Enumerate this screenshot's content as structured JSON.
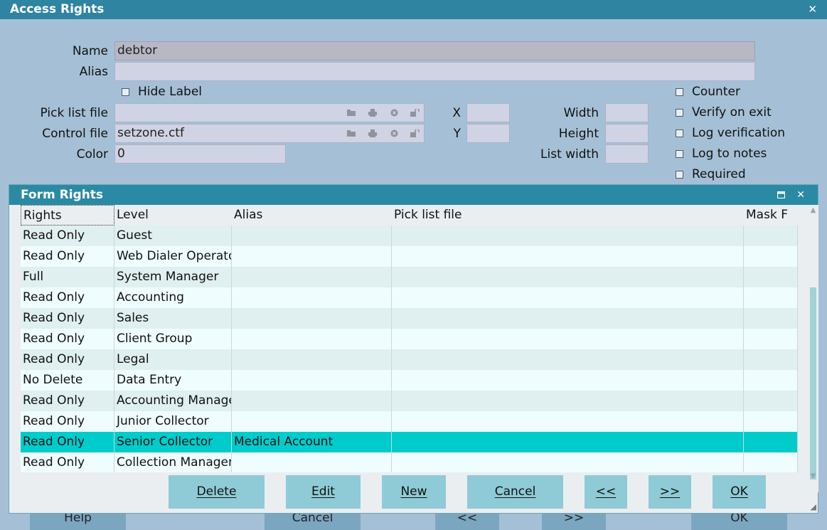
{
  "window": {
    "title": "Access Rights",
    "close_glyph": "✕"
  },
  "form": {
    "name_label": "Name",
    "name_value": "debtor",
    "alias_label": "Alias",
    "alias_value": "",
    "hide_label": "Hide Label",
    "pick_list_label": "Pick list file",
    "pick_list_value": "",
    "control_file_label": "Control file",
    "control_file_value": "setzone.ctf",
    "color_label": "Color",
    "color_value": "0",
    "x_label": "X",
    "x_value": "",
    "y_label": "Y",
    "y_value": "",
    "width_label": "Width",
    "width_value": "",
    "height_label": "Height",
    "height_value": "",
    "list_width_label": "List width",
    "list_width_value": "",
    "checkboxes": [
      "Counter",
      "Verify on exit",
      "Log verification",
      "Log to notes",
      "Required"
    ]
  },
  "behind_buttons": [
    "Help",
    "Cancel",
    "<<",
    ">>",
    "OK"
  ],
  "inner": {
    "title": "Form Rights",
    "columns": [
      "Rights",
      "Level",
      "Alias",
      "Pick list file",
      "Mask F"
    ],
    "rows": [
      {
        "rights": "Read Only",
        "level": "Guest",
        "alias": "",
        "pick": "",
        "mask": ""
      },
      {
        "rights": "Read Only",
        "level": "Web Dialer Operator",
        "alias": "",
        "pick": "",
        "mask": ""
      },
      {
        "rights": "Full",
        "level": "System Manager",
        "alias": "",
        "pick": "",
        "mask": ""
      },
      {
        "rights": "Read Only",
        "level": "Accounting",
        "alias": "",
        "pick": "",
        "mask": ""
      },
      {
        "rights": "Read Only",
        "level": "Sales",
        "alias": "",
        "pick": "",
        "mask": ""
      },
      {
        "rights": "Read Only",
        "level": "Client Group",
        "alias": "",
        "pick": "",
        "mask": ""
      },
      {
        "rights": "Read Only",
        "level": "Legal",
        "alias": "",
        "pick": "",
        "mask": ""
      },
      {
        "rights": "No Delete",
        "level": "Data Entry",
        "alias": "",
        "pick": "",
        "mask": ""
      },
      {
        "rights": "Read Only",
        "level": "Accounting Manager",
        "alias": "",
        "pick": "",
        "mask": ""
      },
      {
        "rights": "Read Only",
        "level": "Junior Collector",
        "alias": "",
        "pick": "",
        "mask": ""
      },
      {
        "rights": "Read Only",
        "level": "Senior Collector",
        "alias": "Medical Account",
        "pick": "",
        "mask": "",
        "selected": true
      },
      {
        "rights": "Read Only",
        "level": "Collection Manager",
        "alias": "",
        "pick": "",
        "mask": ""
      }
    ],
    "buttons": [
      "Delete",
      "Edit",
      "New",
      "Cancel",
      "<<",
      ">>",
      "OK"
    ]
  },
  "colors": {
    "titlebar": "#2e84a1",
    "selected_row": "#00cccc",
    "row_even": "#e0efef",
    "row_odd": "#f0fdfe",
    "button": "#8ecbd6"
  }
}
